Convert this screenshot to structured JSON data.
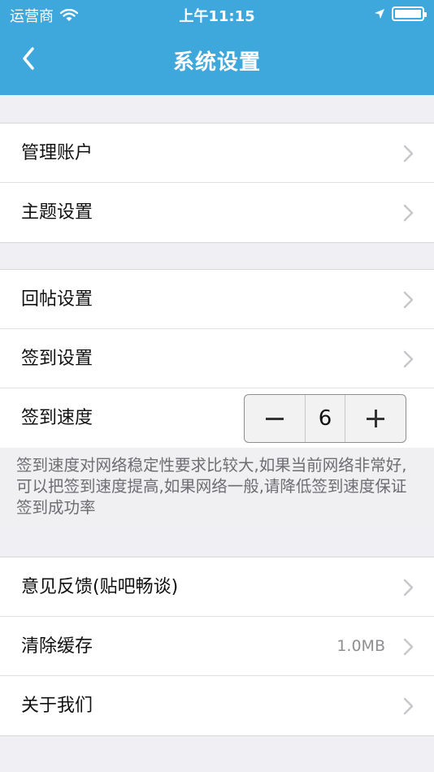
{
  "status_bar": {
    "carrier": "运营商",
    "time": "上午11:15"
  },
  "nav": {
    "title": "系统设置",
    "back_icon": "chevron-left-icon"
  },
  "group1": {
    "items": [
      {
        "label": "管理账户"
      },
      {
        "label": "主题设置"
      }
    ]
  },
  "group2": {
    "items": [
      {
        "label": "回帖设置"
      },
      {
        "label": "签到设置"
      }
    ],
    "speed": {
      "label": "签到速度",
      "value": "6"
    }
  },
  "hint": "签到速度对网络稳定性要求比较大,如果当前网络非常好,可以把签到速度提高,如果网络一般,请降低签到速度保证签到成功率",
  "group3": {
    "items": [
      {
        "label": "意见反馈(贴吧畅谈)"
      },
      {
        "label": "清除缓存",
        "value": "1.0MB"
      },
      {
        "label": "关于我们"
      }
    ]
  },
  "colors": {
    "header_bg": "#3ea8dd",
    "page_bg": "#efeff4"
  }
}
